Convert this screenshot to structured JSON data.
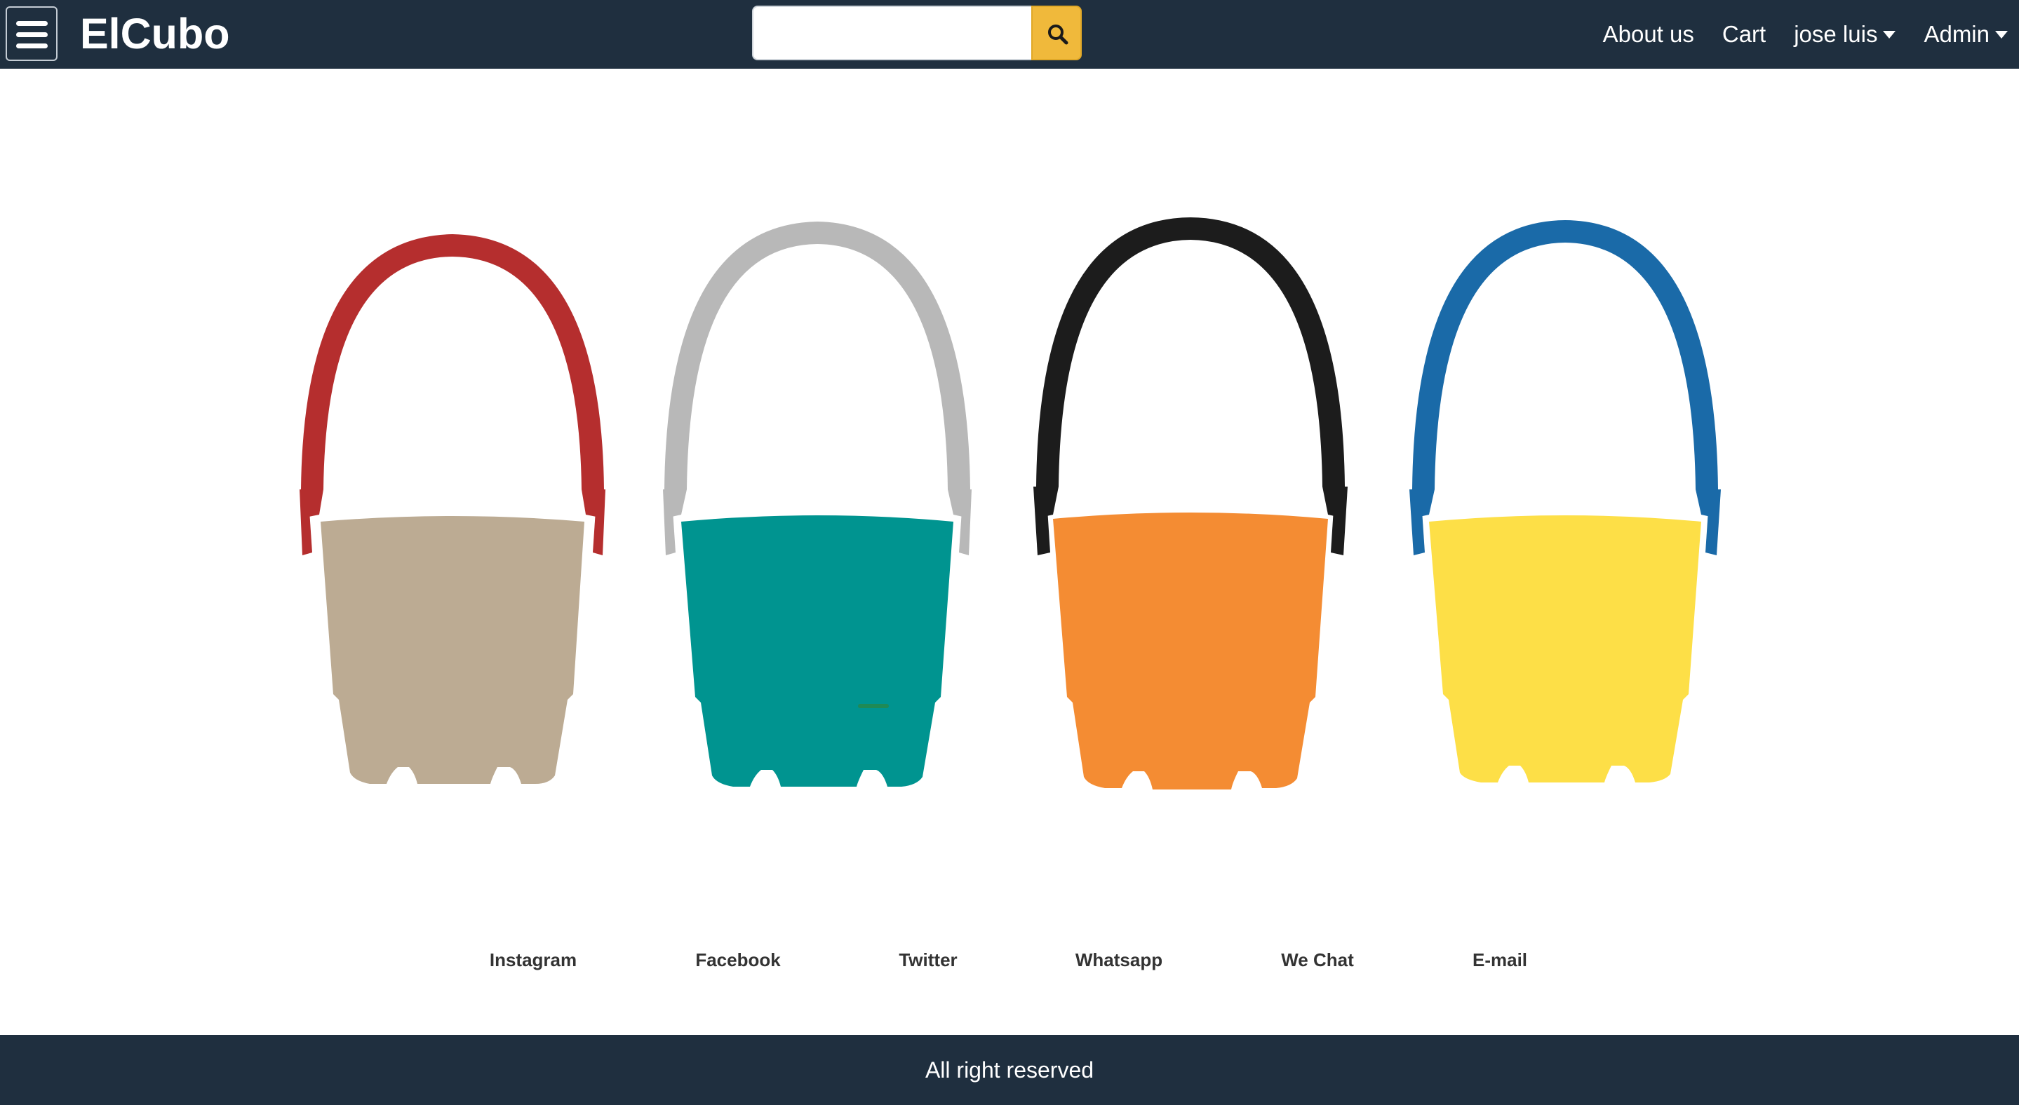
{
  "navbar": {
    "brand": "ElCubo",
    "search": {
      "placeholder": "",
      "value": ""
    },
    "links": {
      "about": "About us",
      "cart": "Cart",
      "user": "jose luis",
      "admin": "Admin"
    }
  },
  "hero": {
    "buckets": [
      {
        "name": "bucket-beige",
        "body_color": "#bcab93",
        "handle_color": "#b52e2e"
      },
      {
        "name": "bucket-teal",
        "body_color": "#009490",
        "handle_color": "#b8b8b8"
      },
      {
        "name": "bucket-orange",
        "body_color": "#f48c33",
        "handle_color": "#1c1c1c"
      },
      {
        "name": "bucket-yellow",
        "body_color": "#fddf47",
        "handle_color": "#1a6aa8"
      }
    ]
  },
  "social": {
    "instagram": "Instagram",
    "facebook": "Facebook",
    "twitter": "Twitter",
    "whatsapp": "Whatsapp",
    "wechat": "We Chat",
    "email": "E-mail"
  },
  "footer": {
    "text": "All right reserved"
  },
  "colors": {
    "navbar_bg": "#1f2f3f",
    "search_button": "#f0b93b",
    "footer_bg": "#1f2f3f"
  }
}
